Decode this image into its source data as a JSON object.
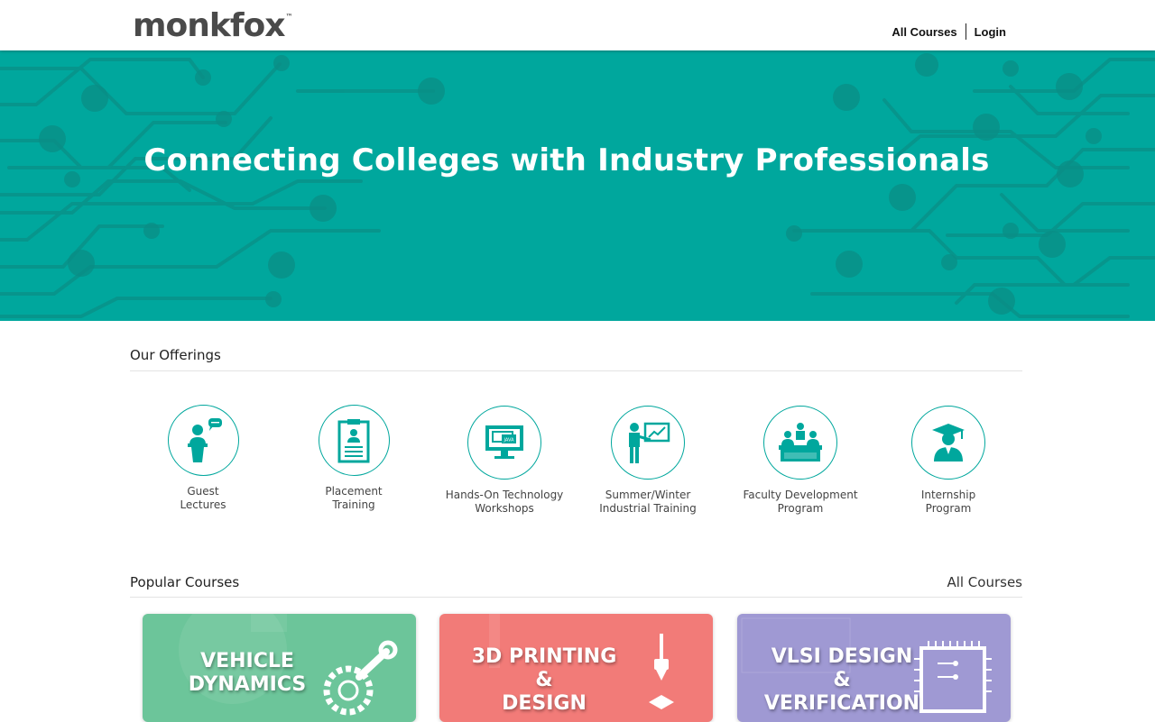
{
  "header": {
    "logo_text": "monkfox",
    "logo_tm": "™",
    "nav": {
      "all_courses": "All Courses",
      "login": "Login"
    }
  },
  "hero": {
    "title": "Connecting Colleges with Industry Professionals",
    "background_color": "#00a79d"
  },
  "offerings": {
    "title": "Our Offerings",
    "items": [
      {
        "line1": "Guest",
        "line2": "Lectures",
        "icon": "podium-speaker-icon"
      },
      {
        "line1": "Placement",
        "line2": "Training",
        "icon": "resume-clipboard-icon"
      },
      {
        "line1": "Hands-On Technology",
        "line2": "Workshops",
        "icon": "java-monitor-icon"
      },
      {
        "line1": "Summer/Winter",
        "line2": "Industrial Training",
        "icon": "trainer-board-icon"
      },
      {
        "line1": "Faculty Development",
        "line2": "Program",
        "icon": "faculty-desk-icon"
      },
      {
        "line1": "Internship",
        "line2": "Program",
        "icon": "graduate-icon"
      }
    ]
  },
  "courses": {
    "title": "Popular Courses",
    "all_link": "All Courses",
    "items": [
      {
        "line1": "VEHICLE",
        "line2": "DYNAMICS",
        "line3": "",
        "color": "#6cc59a",
        "icon": "gear-wrench-icon"
      },
      {
        "line1": "3D PRINTING",
        "line2": "&",
        "line3": "DESIGN",
        "color": "#f27b78",
        "icon": "printer-nozzle-icon"
      },
      {
        "line1": "VLSI DESIGN",
        "line2": "&",
        "line3": "VERIFICATION",
        "color": "#9f99d3",
        "icon": "chip-icon"
      }
    ]
  },
  "accent_color": "#00a79d"
}
